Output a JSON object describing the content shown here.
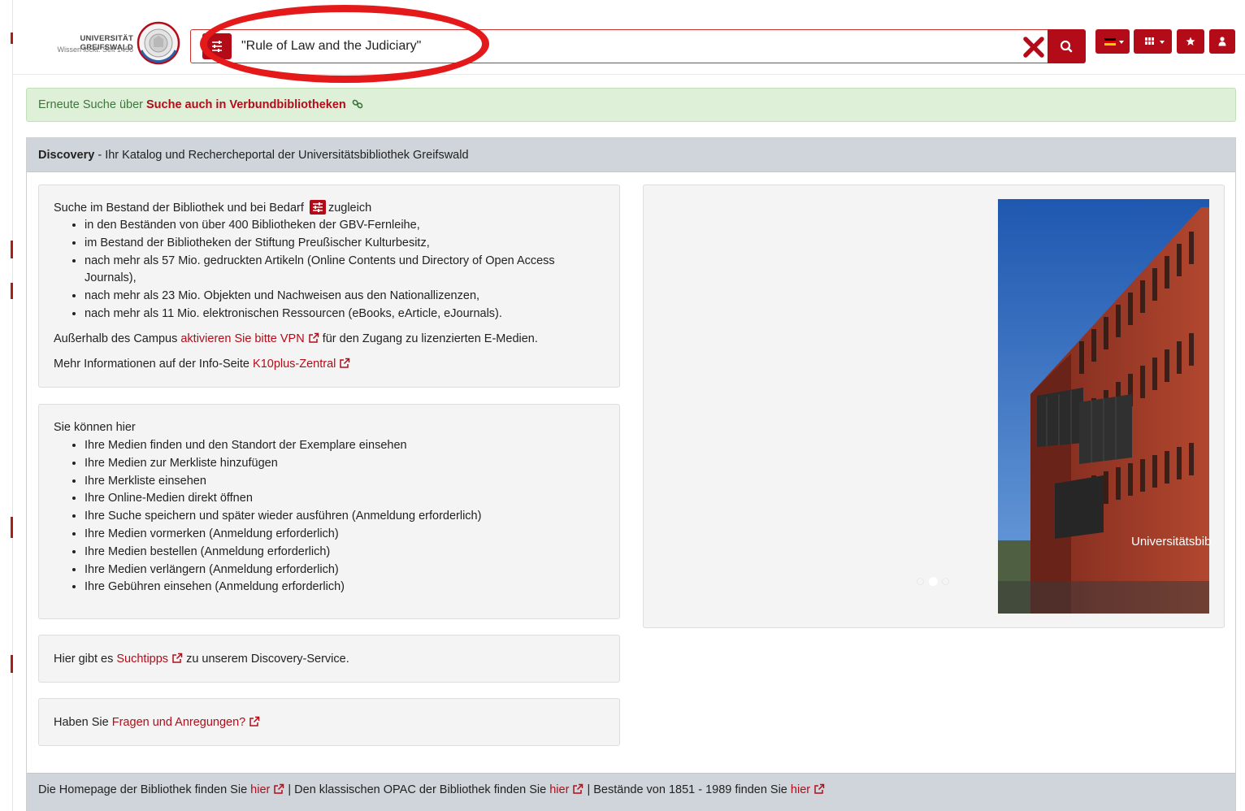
{
  "header": {
    "logo_title": "UNIVERSITÄT GREIFSWALD",
    "logo_subtitle": "Wissen lockt. Seit 1456",
    "search_value": "\"Rule of Law and the Judiciary\"",
    "brand_color": "#b30c18",
    "highlight_color": "#e41a1a",
    "icons": {
      "filter": "sliders-icon",
      "clear": "close-x-icon",
      "search": "magnifier-icon",
      "language": "german-flag-icon",
      "view": "grid-icon",
      "favorites": "star-icon",
      "account": "user-icon"
    }
  },
  "notice": {
    "prefix": "Erneute Suche über ",
    "link": "Suche auch in Verbundbibliotheken",
    "icon": "link-icon"
  },
  "panel": {
    "title_bold": "Discovery",
    "title_rest": " - Ihr Katalog und Rechercheportal der Universitätsbibliothek Greifswald"
  },
  "intro": {
    "lead_before": "Suche im Bestand der Bibliothek und bei Bedarf",
    "lead_after": "zugleich",
    "items": [
      "in den Beständen von über 400 Bibliotheken der GBV-Fernleihe,",
      "im Bestand der Bibliotheken der Stiftung Preußischer Kulturbesitz,",
      "nach mehr als 57 Mio. gedruckten Artikeln (Online Contents und Directory of Open Access",
      "Journals),",
      "nach mehr als 23 Mio. Objekten und Nachweisen aus den Nationallizenzen,",
      "nach mehr als 11 Mio. elektronischen Ressourcen (eBooks, eArticle, eJournals)."
    ],
    "vpn_prefix": "Außerhalb des Campus ",
    "vpn_link": "aktivieren Sie bitte VPN",
    "vpn_suffix": " für den Zugang zu lizenzierten E-Medien.",
    "info_prefix": "Mehr Informationen auf der Info-Seite ",
    "info_link": "K10plus-Zentral"
  },
  "features": {
    "lead": "Sie können hier",
    "items": [
      "Ihre Medien finden und den Standort der Exemplare einsehen",
      "Ihre Medien zur Merkliste hinzufügen",
      "Ihre Merkliste einsehen",
      "Ihre Online-Medien direkt öffnen",
      "Ihre Suche speichern und später wieder ausführen (Anmeldung erforderlich)",
      "Ihre Medien vormerken (Anmeldung erforderlich)",
      "Ihre Medien bestellen (Anmeldung erforderlich)",
      "Ihre Medien verlängern (Anmeldung erforderlich)",
      "Ihre Gebühren einsehen (Anmeldung erforderlich)"
    ]
  },
  "tips": {
    "prefix": "Hier gibt es ",
    "link": "Suchtipps",
    "suffix": " zu unserem Discovery-Service."
  },
  "questions": {
    "prefix": "Haben Sie ",
    "link": "Fragen und Anregungen?"
  },
  "slider": {
    "caption": "Universitätsbib",
    "active_slide": 2,
    "slide_count": 3
  },
  "footer": {
    "part1": "Die Homepage der Bibliothek finden Sie ",
    "link1": "hier",
    "part2": " | Den klassischen OPAC der Bibliothek finden Sie ",
    "link2": "hier",
    "part3": " | Bestände von 1851 - 1989 finden Sie ",
    "link3": "hier"
  }
}
